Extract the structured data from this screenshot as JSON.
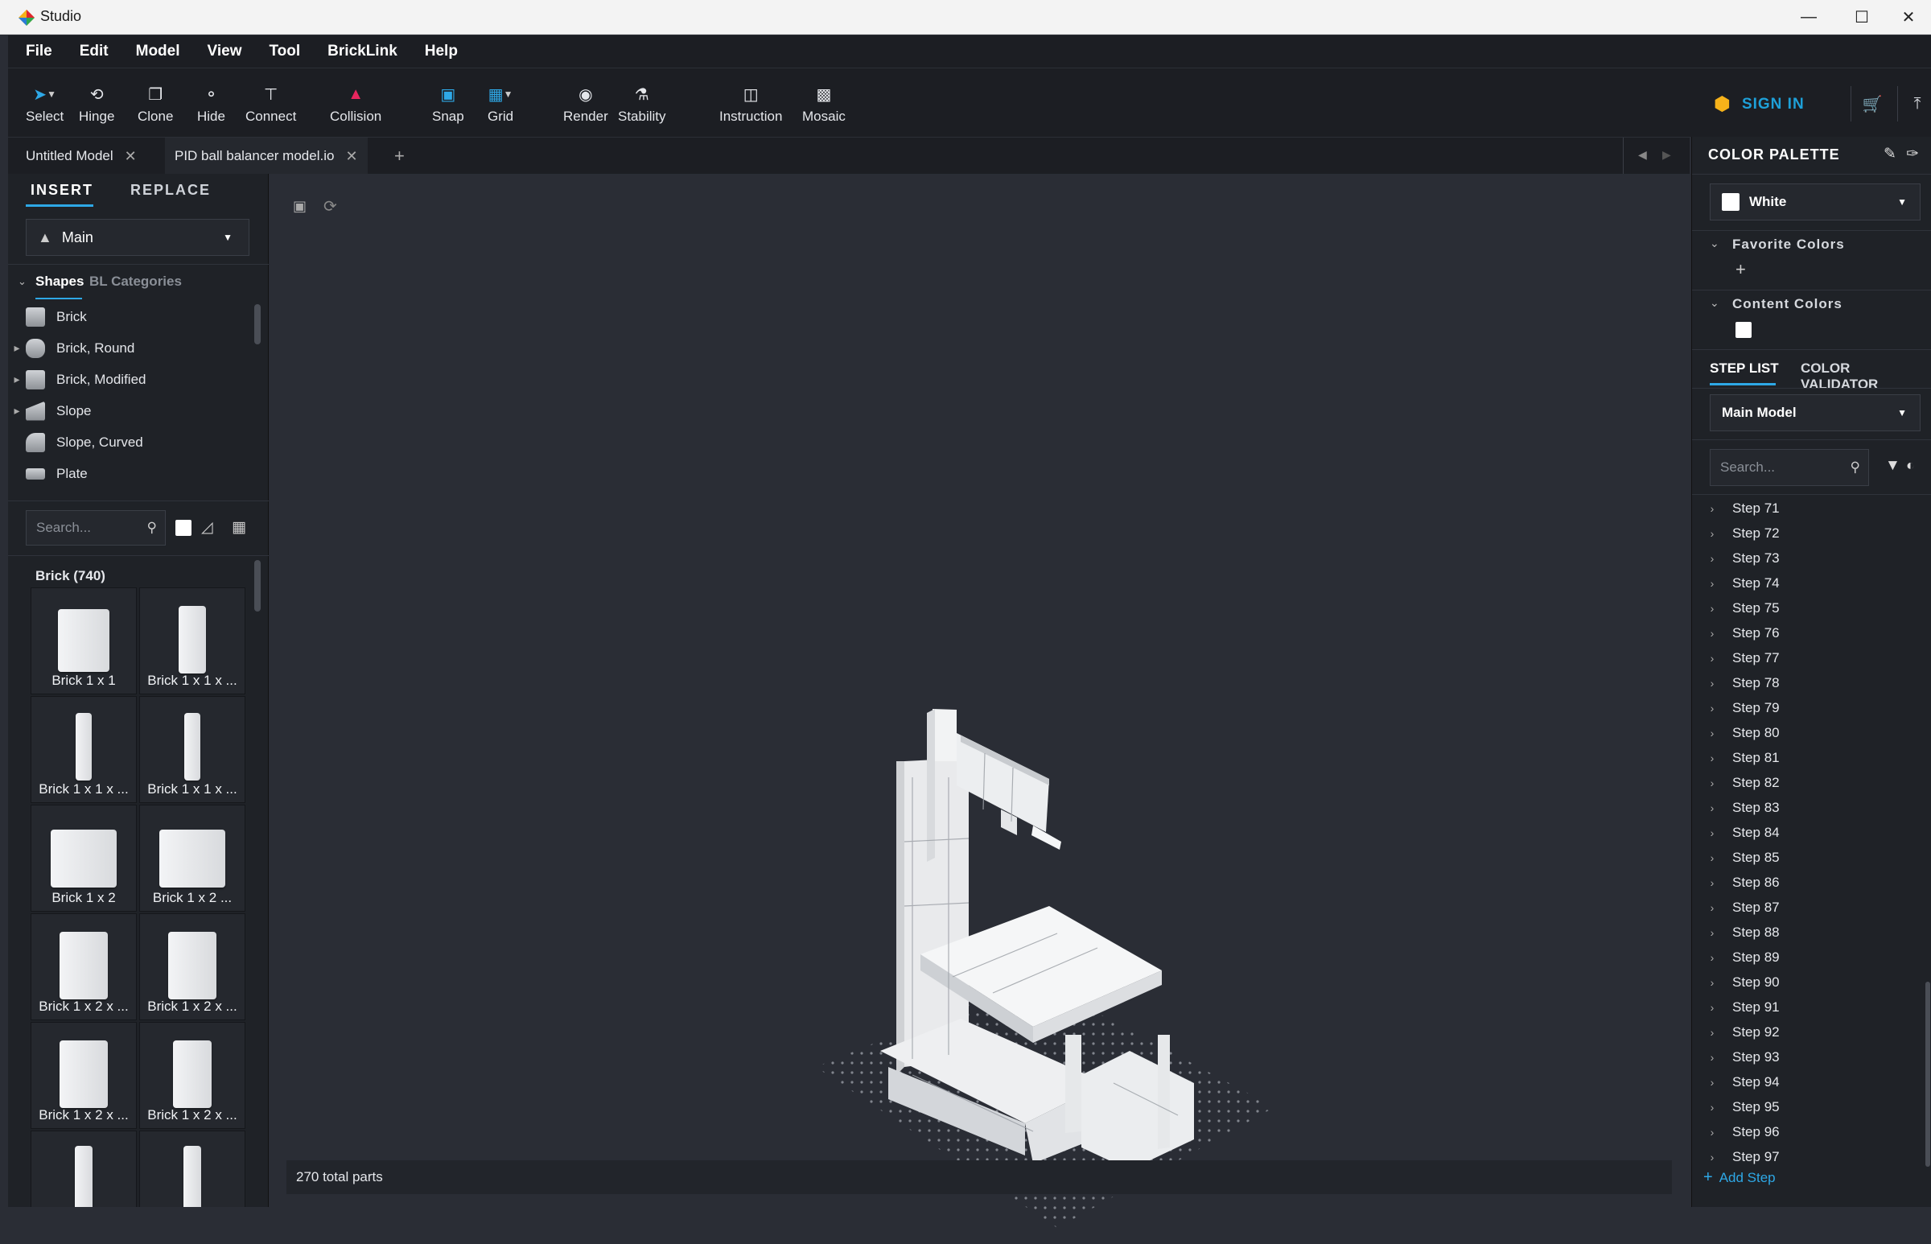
{
  "window": {
    "title": "Studio",
    "controls": [
      "minimize",
      "maximize",
      "close"
    ]
  },
  "menu": [
    "File",
    "Edit",
    "Model",
    "View",
    "Tool",
    "BrickLink",
    "Help"
  ],
  "toolbar": {
    "tools": [
      {
        "label": "Select",
        "icon": "cursor-icon"
      },
      {
        "label": "Hinge",
        "icon": "hinge-icon"
      },
      {
        "label": "Clone",
        "icon": "clone-icon"
      },
      {
        "label": "Hide",
        "icon": "hide-icon"
      },
      {
        "label": "Connect",
        "icon": "connect-icon"
      },
      {
        "label": "Collision",
        "icon": "collision-icon"
      },
      {
        "label": "Snap",
        "icon": "snap-icon"
      },
      {
        "label": "Grid",
        "icon": "grid-icon"
      },
      {
        "label": "Render",
        "icon": "camera-icon"
      },
      {
        "label": "Stability",
        "icon": "stability-icon"
      },
      {
        "label": "Instruction",
        "icon": "instruction-icon"
      },
      {
        "label": "Mosaic",
        "icon": "mosaic-icon"
      }
    ],
    "sign_in": "SIGN IN",
    "accent": "#1ea0d8",
    "collision_color": "#e8265e"
  },
  "doc_tabs": [
    {
      "label": "Untitled Model",
      "active": false
    },
    {
      "label": "PID ball balancer model.io",
      "active": true
    }
  ],
  "left_panel": {
    "tabs": [
      "INSERT",
      "REPLACE"
    ],
    "palette_dropdown": "Main",
    "category_tabs": [
      "Shapes",
      "BL Categories"
    ],
    "categories": [
      "Brick",
      "Brick, Round",
      "Brick, Modified",
      "Slope",
      "Slope, Curved",
      "Plate"
    ],
    "search_placeholder": "Search...",
    "group_title": "Brick (740)",
    "parts": [
      "Brick 1 x 1",
      "Brick 1 x 1 x ...",
      "Brick 1 x 1 x ...",
      "Brick 1 x 1 x ...",
      "Brick 1 x 2",
      "Brick 1 x 2 ...",
      "Brick 1 x 2 x ...",
      "Brick 1 x 2 x ...",
      "Brick 1 x 2 x ...",
      "Brick 1 x 2 x ..."
    ]
  },
  "viewport": {
    "status": "270 total parts"
  },
  "right_panel": {
    "color_palette_title": "COLOR PALETTE",
    "selected_color": "White",
    "favorite_colors": "Favorite Colors",
    "content_colors": "Content Colors",
    "tabs": [
      "STEP LIST",
      "COLOR VALIDATOR"
    ],
    "model_dropdown": "Main Model",
    "search_placeholder": "Search...",
    "steps": [
      "Step 71",
      "Step 72",
      "Step 73",
      "Step 74",
      "Step 75",
      "Step 76",
      "Step 77",
      "Step 78",
      "Step 79",
      "Step 80",
      "Step 81",
      "Step 82",
      "Step 83",
      "Step 84",
      "Step 85",
      "Step 86",
      "Step 87",
      "Step 88",
      "Step 89",
      "Step 90",
      "Step 91",
      "Step 92",
      "Step 93",
      "Step 94",
      "Step 95",
      "Step 96",
      "Step 97"
    ],
    "add_step": "Add Step"
  }
}
